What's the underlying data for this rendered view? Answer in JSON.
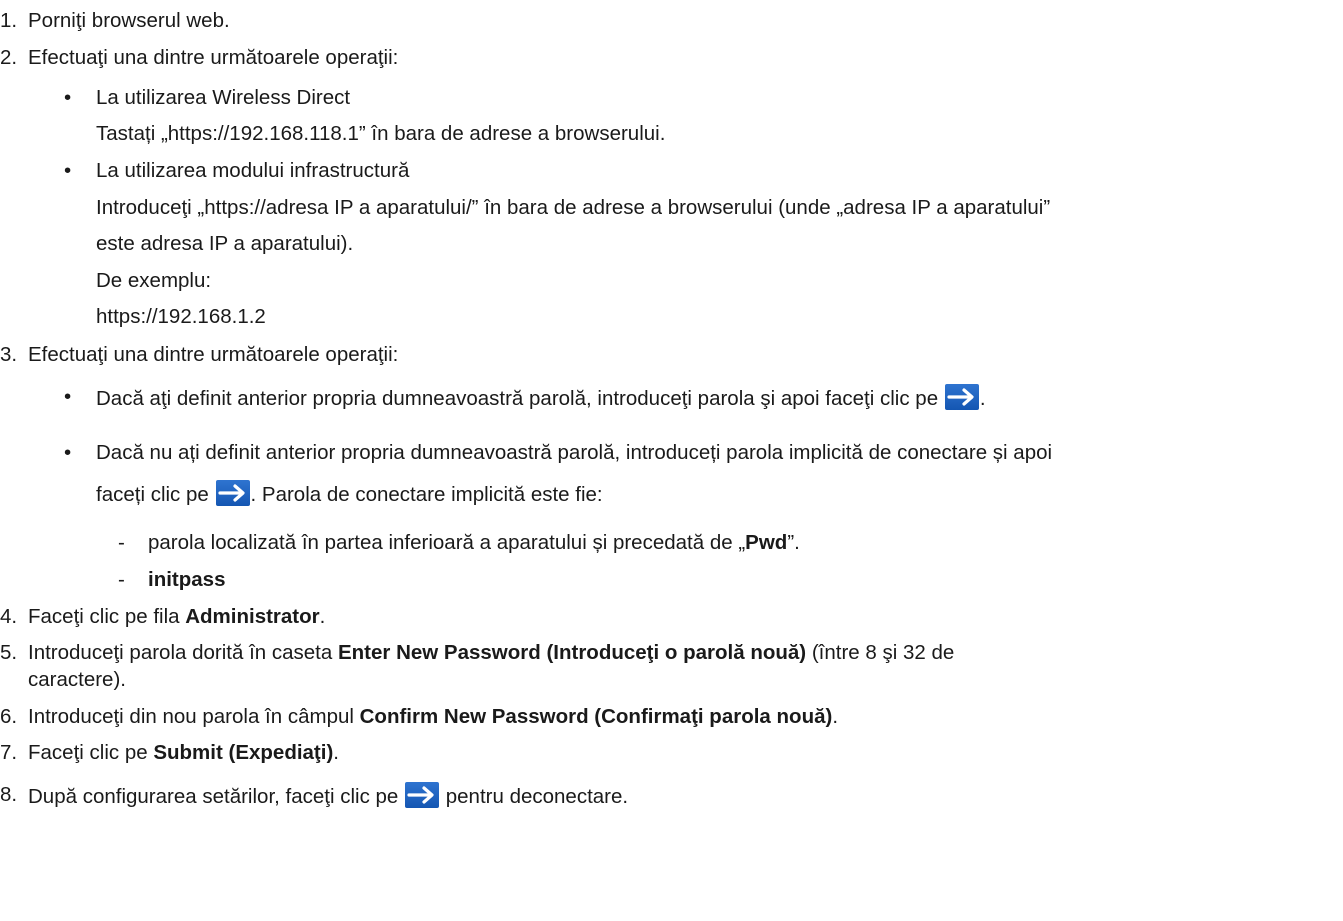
{
  "steps": {
    "s1": "1.",
    "s1_text": "Porniţi browserul web.",
    "s2": "2.",
    "s2_text": "Efectuaţi una dintre următoarele operaţii:",
    "s2_b1": "La utilizarea Wireless Direct",
    "s2_b1_detail": "Tastați „https://192.168.118.1” în bara de adrese a browserului.",
    "s2_b2": "La utilizarea modului infrastructură",
    "s2_b2_detail_l1": "Introduceţi „https://adresa IP a aparatului/” în bara de adrese a browserului (unde „adresa IP a aparatului”",
    "s2_b2_detail_l2": "este adresa IP a aparatului).",
    "s2_b2_example_label": "De exemplu:",
    "s2_b2_example": "https://192.168.1.2",
    "s3": "3.",
    "s3_text": "Efectuaţi una dintre următoarele operaţii:",
    "s3_b1_pre": "Dacă aţi definit anterior propria dumneavoastră parolă, introduceţi parola şi apoi faceţi clic pe",
    "s3_b1_post": ".",
    "s3_b2_l1": "Dacă nu ați definit anterior propria dumneavoastră parolă, introduceți parola implicită de conectare și apoi",
    "s3_b2_l2_pre": "faceți clic pe",
    "s3_b2_l2_post": ". Parola de conectare implicită este fie:",
    "s3_d1_pre": "parola localizată în partea inferioară a aparatului și precedată de „",
    "s3_d1_bold": "Pwd",
    "s3_d1_post": "”.",
    "s3_d2": "initpass",
    "s4": "4.",
    "s4_pre": "Faceţi clic pe fila ",
    "s4_bold": "Administrator",
    "s4_post": ".",
    "s5": "5.",
    "s5_pre": "Introduceţi parola dorită în caseta ",
    "s5_bold": "Enter New Password (Introduceţi o parolă nouă)",
    "s5_post": " (între 8 şi 32 de",
    "s5_l2": "caractere).",
    "s6": "6.",
    "s6_pre": "Introduceţi din nou parola în câmpul ",
    "s6_bold": "Confirm New Password (Confirmaţi parola nouă)",
    "s6_post": ".",
    "s7": "7.",
    "s7_pre": "Faceţi clic pe ",
    "s7_bold": "Submit (Expediaţi)",
    "s7_post": ".",
    "s8": "8.",
    "s8_pre": "După configurarea setărilor, faceţi clic pe",
    "s8_post": "pentru deconectare."
  },
  "icons": {
    "arrow": "arrow-right-icon",
    "arrow_color": "#1f63c2",
    "bullet": "•",
    "dash": "-"
  }
}
